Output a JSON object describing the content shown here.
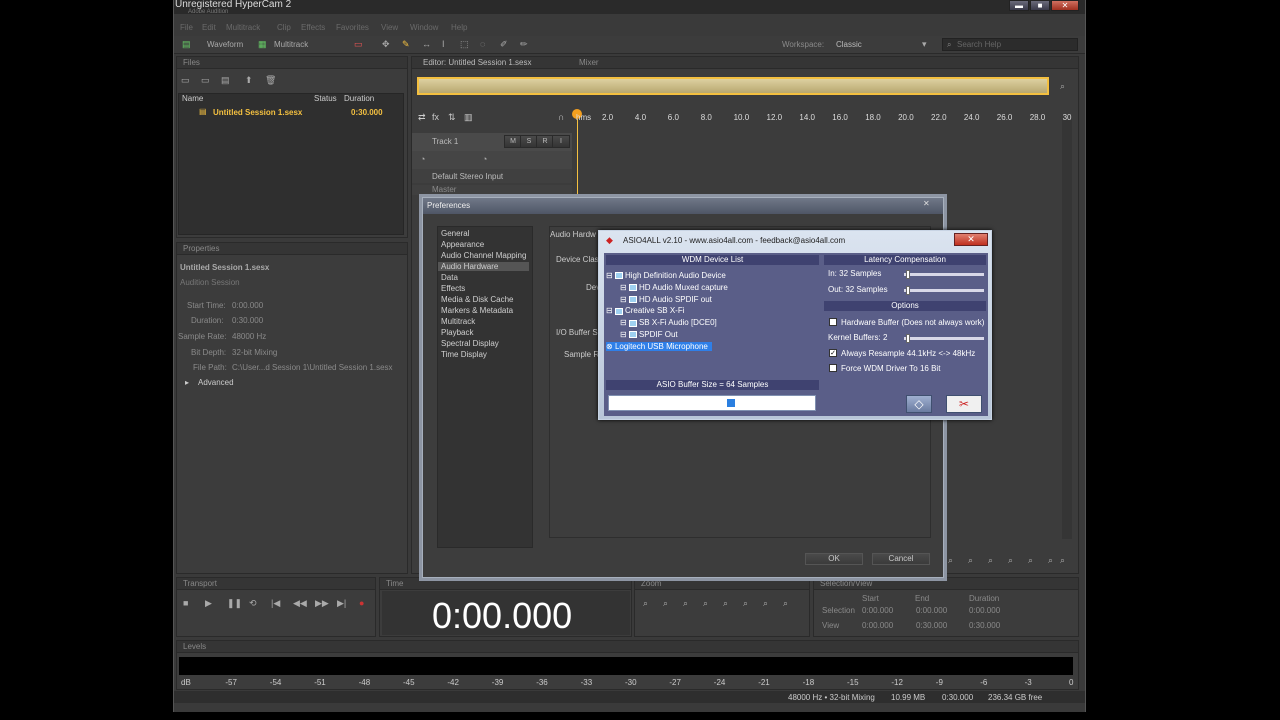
{
  "recorder": {
    "watermark": "Unregistered HyperCam 2",
    "app_name": "Adobe Audition"
  },
  "menu": [
    "File",
    "Edit",
    "Multitrack",
    "Clip",
    "Effects",
    "Favorites",
    "View",
    "Window",
    "Help"
  ],
  "toolbar": {
    "waveform": "Waveform",
    "multitrack": "Multitrack",
    "workspace_label": "Workspace:",
    "workspace_value": "Classic",
    "search_placeholder": "Search Help"
  },
  "files": {
    "title": "Files",
    "columns": [
      "Name",
      "Status",
      "Duration"
    ],
    "rows": [
      {
        "name": "Untitled Session 1.sesx",
        "duration": "0:30.000"
      }
    ]
  },
  "properties": {
    "title": "Properties",
    "name": "Untitled Session 1.sesx",
    "kind": "Audition Session",
    "start_time_label": "Start Time:",
    "start_time": "0:00.000",
    "duration_label": "Duration:",
    "duration": "0:30.000",
    "sample_rate_label": "Sample Rate:",
    "sample_rate": "48000 Hz",
    "bit_depth_label": "Bit Depth:",
    "bit_depth": "32-bit Mixing",
    "file_path_label": "File Path:",
    "file_path": "C:\\User...d Session 1\\Untitled Session 1.sesx",
    "advanced": "Advanced"
  },
  "editor": {
    "tab": "Editor: Untitled Session 1.sesx",
    "mixer_tab": "Mixer",
    "ruler": [
      "hms",
      "2.0",
      "4.0",
      "6.0",
      "8.0",
      "10.0",
      "12.0",
      "14.0",
      "16.0",
      "18.0",
      "20.0",
      "22.0",
      "24.0",
      "26.0",
      "28.0",
      "30"
    ],
    "track_name": "Track 1",
    "track_btns": [
      "M",
      "S",
      "R",
      "I"
    ],
    "input": "Default Stereo Input",
    "master": "Master"
  },
  "preferences": {
    "title": "Preferences",
    "categories": [
      "General",
      "Appearance",
      "Audio Channel Mapping",
      "Audio Hardware",
      "Data",
      "Effects",
      "Media & Disk Cache",
      "Markers & Metadata",
      "Multitrack",
      "Playback",
      "Spectral Display",
      "Time Display"
    ],
    "selected": "Audio Hardware",
    "section": "Audio Hardw",
    "device_class": "Device Clas",
    "device": "Dev",
    "io_buffer": "I/O Buffer S",
    "sample_rate": "Sample R",
    "ok": "OK",
    "cancel": "Cancel"
  },
  "asio": {
    "title": "ASIO4ALL v2.10 - www.asio4all.com - feedback@asio4all.com",
    "device_list_header": "WDM Device List",
    "devices": [
      {
        "label": "High Definition Audio Device",
        "level": 0
      },
      {
        "label": "HD Audio Muxed capture",
        "level": 1
      },
      {
        "label": "HD Audio SPDIF out",
        "level": 1
      },
      {
        "label": "Creative SB X-Fi",
        "level": 0
      },
      {
        "label": "SB X-Fi Audio [DCE0]",
        "level": 1
      },
      {
        "label": "SPDIF Out",
        "level": 1
      },
      {
        "label": "Logitech USB Microphone",
        "level": 0
      }
    ],
    "latency_header": "Latency Compensation",
    "in_label": "In: 32 Samples",
    "out_label": "Out: 32 Samples",
    "options_header": "Options",
    "opt_hw_buffer": "Hardware Buffer (Does not always work)",
    "opt_kernel": "Kernel Buffers: 2",
    "opt_resample": "Always Resample 44.1kHz <-> 48kHz",
    "opt_force": "Force WDM Driver To 16 Bit",
    "buffer_size": "ASIO Buffer Size = 64 Samples"
  },
  "transport": {
    "title": "Transport"
  },
  "time": {
    "title": "Time",
    "value": "0:00.000"
  },
  "zoom": {
    "title": "Zoom"
  },
  "selection": {
    "title": "Selection/View",
    "cols": [
      "Start",
      "End",
      "Duration"
    ],
    "sel_label": "Selection",
    "sel": [
      "0:00.000",
      "0:00.000",
      "0:00.000"
    ],
    "view_label": "View",
    "view": [
      "0:00.000",
      "0:30.000",
      "0:30.000"
    ]
  },
  "levels": {
    "title": "Levels",
    "scale": [
      "dB",
      "-57",
      "-54",
      "-51",
      "-48",
      "-45",
      "-42",
      "-39",
      "-36",
      "-33",
      "-30",
      "-27",
      "-24",
      "-21",
      "-18",
      "-15",
      "-12",
      "-9",
      "-6",
      "-3",
      "0"
    ]
  },
  "status": {
    "format": "48000 Hz • 32-bit Mixing",
    "size": "10.99 MB",
    "duration": "0:30.000",
    "free": "236.34 GB free"
  }
}
